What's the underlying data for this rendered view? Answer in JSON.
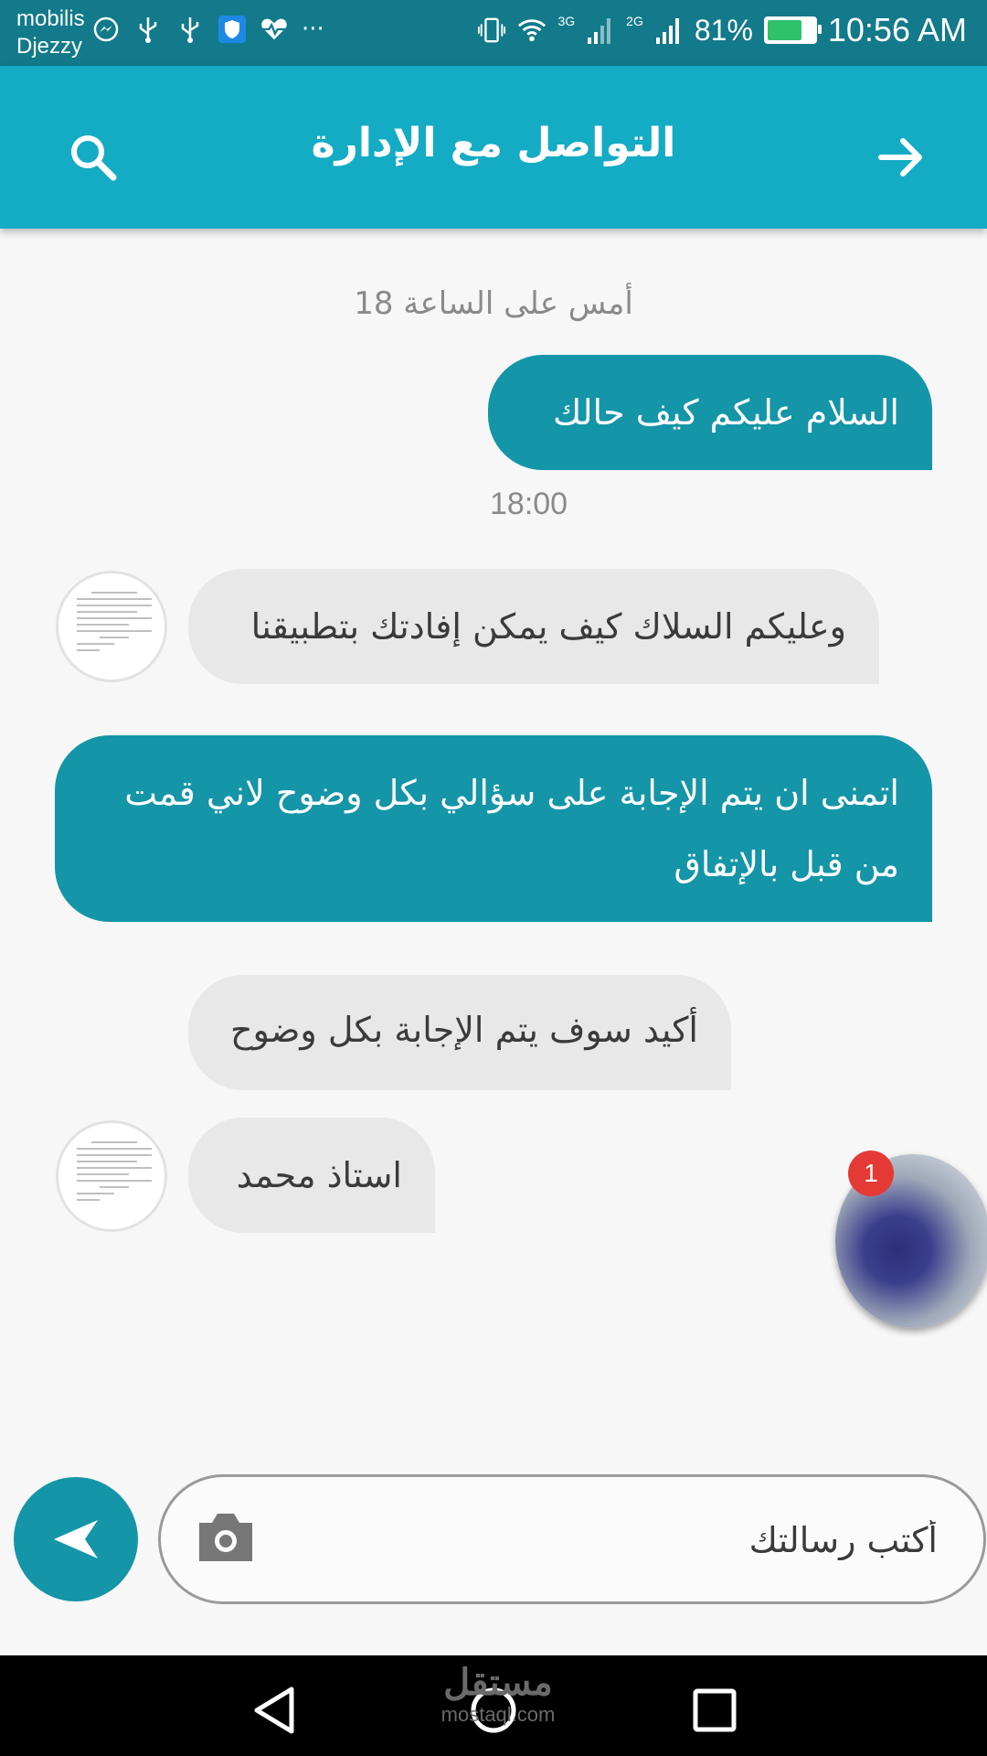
{
  "status_bar": {
    "carrier_1": "mobilis",
    "carrier_2": "Djezzy",
    "network_1": "3G",
    "network_2": "2G",
    "battery_percent": "81%",
    "battery_level": 0.81,
    "time": "10:56 AM",
    "more": "···",
    "icons": [
      "messenger-icon",
      "usb-icon",
      "usb-icon",
      "shield-icon",
      "heart-rate-icon",
      "vibrate-icon",
      "wifi-icon",
      "signal-icon",
      "signal-icon",
      "battery-charging-icon"
    ]
  },
  "app_bar": {
    "title": "التواصل مع الإدارة",
    "search_icon": "search-icon",
    "forward_icon": "arrow-forward-icon",
    "color": "#14abc4"
  },
  "chat": {
    "date_divider": "أمس على الساعة 18",
    "messages": [
      {
        "direction": "out",
        "text": "السلام عليكم كيف حالك",
        "time": "18:00"
      },
      {
        "direction": "in",
        "text": "وعليكم السلاك كيف يمكن إفادتك بتطبيقنا"
      },
      {
        "direction": "out",
        "text": "اتمنى ان يتم الإجابة على سؤالي بكل وضوح لاني قمت من قبل بالإتفاق"
      },
      {
        "direction": "in",
        "text": "أكيد سوف يتم الإجابة بكل وضوح"
      },
      {
        "direction": "in",
        "text": "استاذ محمد"
      }
    ],
    "outgoing_color": "#1495a8",
    "incoming_color": "#e8e8e8"
  },
  "floating_chat_head": {
    "badge": "1"
  },
  "composer": {
    "placeholder": "أكتب رسالتك",
    "camera_icon": "camera-icon",
    "send_icon": "send-icon"
  },
  "nav_bar": {
    "back_icon": "back-triangle-icon",
    "home_icon": "home-circle-icon",
    "recent_icon": "recent-apps-icon"
  },
  "watermark": {
    "arabic": "مستقل",
    "latin": "mostaql.com"
  }
}
